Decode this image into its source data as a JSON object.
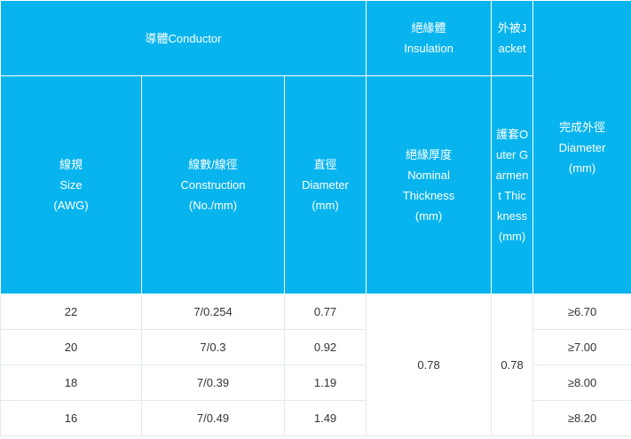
{
  "header": {
    "conductor": "導體Conductor",
    "insulation": [
      "絕緣體",
      "Insulation"
    ],
    "jacket": "外被Jacket",
    "outer_thickness": "護套Outer Garment Thickness(mm)",
    "finished_diameter": [
      "完成外徑",
      "Diameter",
      "(mm)"
    ],
    "size": [
      "線規",
      "Size",
      "(AWG)"
    ],
    "construction": [
      "線數/線徑",
      "Construction",
      "(No./mm)"
    ],
    "conductor_diameter": [
      "直徑",
      "Diameter",
      "(mm)"
    ],
    "nominal_thickness": [
      "絕緣厚度",
      "Nominal",
      "Thickness",
      "(mm)"
    ]
  },
  "rows": [
    {
      "size": "22",
      "construction": "7/0.254",
      "diameter": "0.77",
      "outer": "≥6.70"
    },
    {
      "size": "20",
      "construction": "7/0.3",
      "diameter": "0.92",
      "outer": "≥7.00"
    },
    {
      "size": "18",
      "construction": "7/0.39",
      "diameter": "1.19",
      "outer": "≥8.00"
    },
    {
      "size": "16",
      "construction": "7/0.49",
      "diameter": "1.49",
      "outer": "≥8.20"
    }
  ],
  "insulation_thickness": "0.78",
  "jacket_thickness": "0.78"
}
